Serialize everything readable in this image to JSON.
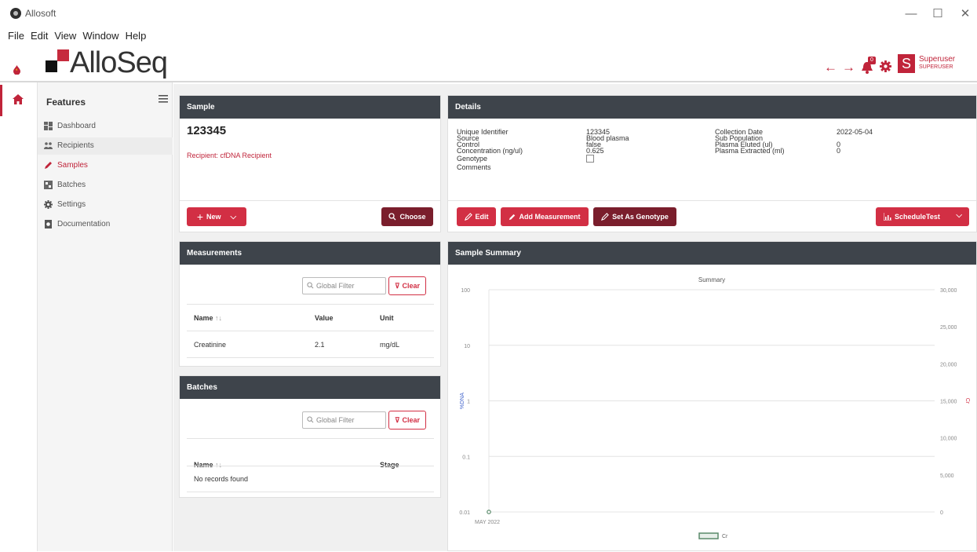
{
  "window": {
    "title": "Allosoft",
    "controls": {
      "minimize": "—",
      "maximize": "☐",
      "close": "✕"
    }
  },
  "menubar": [
    "File",
    "Edit",
    "View",
    "Window",
    "Help"
  ],
  "header": {
    "logo_text": "AlloSeq",
    "notification_count": "0",
    "user_initial": "S",
    "user_name": "Superuser",
    "user_role": "SUPERUSER"
  },
  "sidebar": {
    "title": "Features",
    "items": [
      {
        "label": "Dashboard",
        "icon": "dashboard-icon"
      },
      {
        "label": "Recipients",
        "icon": "people-icon"
      },
      {
        "label": "Samples",
        "icon": "pencil-icon",
        "active": true
      },
      {
        "label": "Batches",
        "icon": "batch-icon"
      },
      {
        "label": "Settings",
        "icon": "gear-icon"
      },
      {
        "label": "Documentation",
        "icon": "document-icon"
      }
    ]
  },
  "sample": {
    "header": "Sample",
    "id": "123345",
    "recipient": "Recipient: cfDNA Recipient",
    "new_label": "New",
    "choose_label": "Choose"
  },
  "details": {
    "header": "Details",
    "left_labels": [
      "Unique Identifier",
      "Source",
      "Control",
      "Concentration (ng/ul)",
      "Genotype",
      "Comments"
    ],
    "left_values": [
      "123345",
      "Blood plasma",
      "false",
      "0.625"
    ],
    "right_labels": [
      "Collection Date",
      "Sub Population",
      "Plasma Eluted (ul)",
      "Plasma Extracted (ml)"
    ],
    "right_values": [
      "2022-05-04",
      "",
      "0",
      "0"
    ],
    "edit_label": "Edit",
    "add_measurement_label": "Add Measurement",
    "set_genotype_label": "Set As Genotype",
    "schedule_label": "ScheduleTest"
  },
  "measurements": {
    "header": "Measurements",
    "filter_placeholder": "Global Filter",
    "clear_label": "Clear",
    "columns": [
      "Name",
      "Value",
      "Unit"
    ],
    "rows": [
      [
        "Creatinine",
        "2.1",
        "mg/dL"
      ]
    ]
  },
  "batches": {
    "header": "Batches",
    "filter_placeholder": "Global Filter",
    "clear_label": "Clear",
    "columns": [
      "Name",
      "Stage"
    ],
    "empty_text": "No records found"
  },
  "summary": {
    "header": "Sample Summary"
  },
  "chart_data": {
    "type": "line",
    "title": "Summary",
    "xlabel": "",
    "x_ticks": [
      "MAY 2022"
    ],
    "ylabel_left": "%DNA",
    "ylabel_right": "Cr",
    "y_left_scale": "log",
    "y_left_ticks": [
      "100",
      "10",
      "1",
      "0.1",
      "0.01"
    ],
    "y_left_range": [
      0.01,
      100
    ],
    "y_right_ticks": [
      "30,000",
      "25,000",
      "20,000",
      "15,000",
      "10,000",
      "5,000",
      "0"
    ],
    "y_right_range": [
      0,
      30000
    ],
    "grid": true,
    "legend_position": "bottom",
    "series": [
      {
        "name": "Cr",
        "axis": "right",
        "x": [
          "MAY 2022"
        ],
        "values": [
          2.1
        ],
        "color": "#5a8a6a"
      }
    ],
    "colors": {
      "left_axis_label": "#4466cc",
      "right_axis_label": "#d22f44"
    }
  },
  "colors": {
    "accent": "#d22f44",
    "dark_accent": "#7a1e2c",
    "card_header": "#3e444b"
  }
}
